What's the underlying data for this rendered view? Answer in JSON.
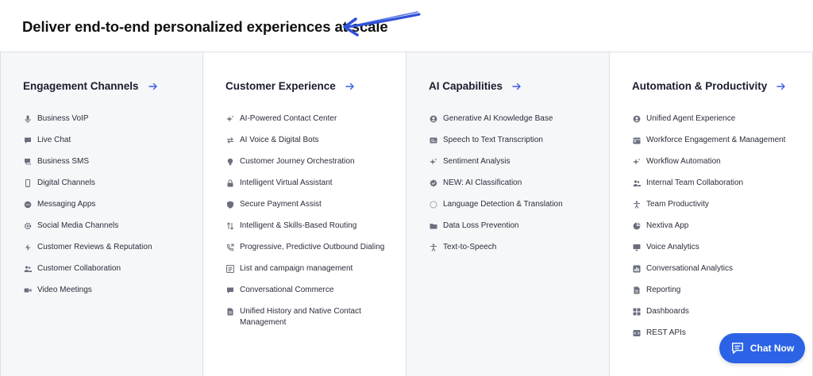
{
  "headline": "Deliver end-to-end personalized experiences at scale",
  "accent_color": "#3a5ee8",
  "columns": [
    {
      "title": "Engagement Channels",
      "items": [
        {
          "label": "Business VoIP",
          "icon": "microphone-icon"
        },
        {
          "label": "Live Chat",
          "icon": "chat-bubble-icon"
        },
        {
          "label": "Business SMS",
          "icon": "sms-icon"
        },
        {
          "label": "Digital Channels",
          "icon": "phone-device-icon"
        },
        {
          "label": "Messaging Apps",
          "icon": "message-icon"
        },
        {
          "label": "Social Media Channels",
          "icon": "gear-icon"
        },
        {
          "label": "Customer Reviews & Reputation",
          "icon": "lightning-icon"
        },
        {
          "label": "Customer Collaboration",
          "icon": "users-icon"
        },
        {
          "label": "Video Meetings",
          "icon": "video-camera-icon"
        }
      ]
    },
    {
      "title": "Customer Experience",
      "items": [
        {
          "label": "AI-Powered Contact Center",
          "icon": "sparkle-icon"
        },
        {
          "label": "AI Voice & Digital Bots",
          "icon": "swap-arrows-icon"
        },
        {
          "label": "Customer Journey Orchestration",
          "icon": "lightbulb-icon"
        },
        {
          "label": "Intelligent Virtual Assistant",
          "icon": "lock-icon"
        },
        {
          "label": "Secure Payment Assist",
          "icon": "shield-icon"
        },
        {
          "label": "Intelligent & Skills-Based Routing",
          "icon": "sort-arrows-icon"
        },
        {
          "label": "Progressive, Predictive Outbound Dialing",
          "icon": "phone-outbound-icon"
        },
        {
          "label": "List and campaign management",
          "icon": "list-icon"
        },
        {
          "label": "Conversational Commerce",
          "icon": "chat-bubble-icon"
        },
        {
          "label": "Unified History and Native Contact Management",
          "icon": "document-icon"
        }
      ]
    },
    {
      "title": "AI Capabilities",
      "items": [
        {
          "label": "Generative AI Knowledge Base",
          "icon": "user-circle-icon"
        },
        {
          "label": "Speech to Text Transcription",
          "icon": "caption-icon"
        },
        {
          "label": "Sentiment Analysis",
          "icon": "sparkle-icon"
        },
        {
          "label": "NEW: AI Classification",
          "icon": "badge-check-icon"
        },
        {
          "label": "Language Detection & Translation",
          "icon": "dotted-circle-icon"
        },
        {
          "label": "Data Loss Prevention",
          "icon": "folder-icon"
        },
        {
          "label": "Text-to-Speech",
          "icon": "accessibility-icon"
        }
      ]
    },
    {
      "title": "Automation & Productivity",
      "items": [
        {
          "label": "Unified Agent Experience",
          "icon": "user-circle-icon"
        },
        {
          "label": "Workforce Engagement & Management",
          "icon": "calendar-icon"
        },
        {
          "label": "Workflow Automation",
          "icon": "sparkle-icon"
        },
        {
          "label": "Internal Team Collaboration",
          "icon": "users-icon"
        },
        {
          "label": "Team Productivity",
          "icon": "accessibility-icon"
        },
        {
          "label": "Nextiva App",
          "icon": "pie-chart-icon"
        },
        {
          "label": "Voice Analytics",
          "icon": "monitor-icon"
        },
        {
          "label": "Conversational Analytics",
          "icon": "bar-chart-icon"
        },
        {
          "label": "Reporting",
          "icon": "document-icon"
        },
        {
          "label": "Dashboards",
          "icon": "grid-icon"
        },
        {
          "label": "REST APIs",
          "icon": "code-icon"
        }
      ]
    }
  ],
  "chat_button": {
    "label": "Chat Now",
    "icon": "chat-icon",
    "color": "#2c63e6"
  }
}
